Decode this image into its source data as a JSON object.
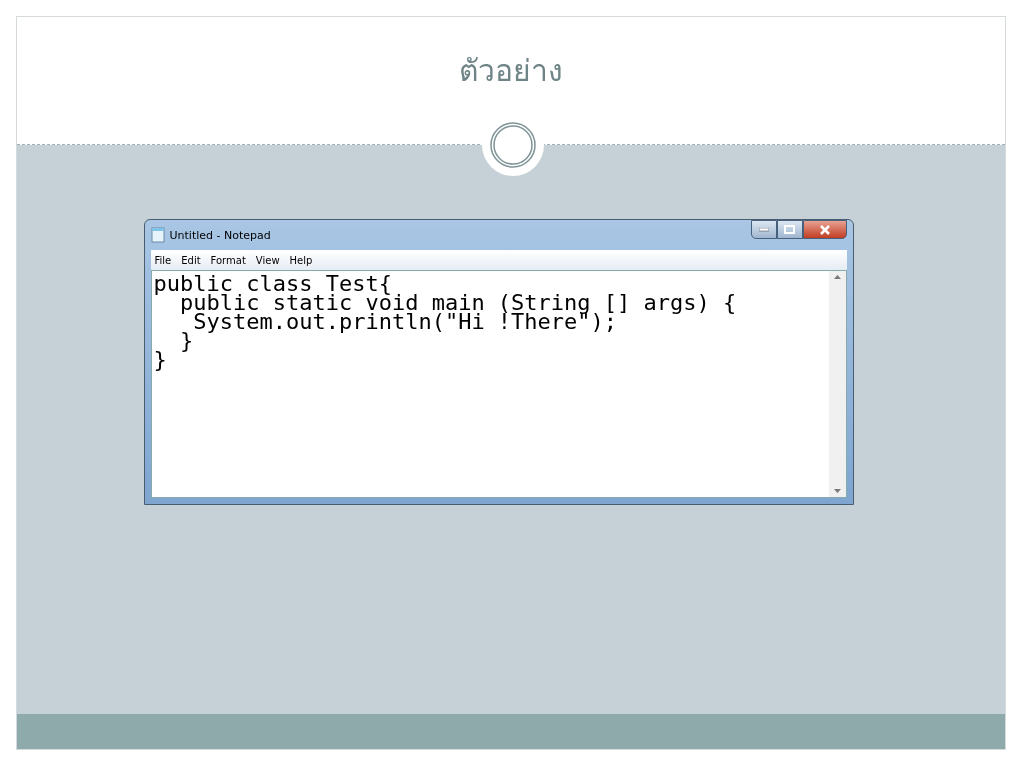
{
  "slide": {
    "title": "ตัวอย่าง"
  },
  "window": {
    "title": "Untitled - Notepad",
    "menu": [
      "File",
      "Edit",
      "Format",
      "View",
      "Help"
    ],
    "lines": [
      "public class Test{",
      "  public static void main (String [] args) {",
      "   System.out.println(\"Hi !There\");",
      "  }",
      "}"
    ]
  }
}
